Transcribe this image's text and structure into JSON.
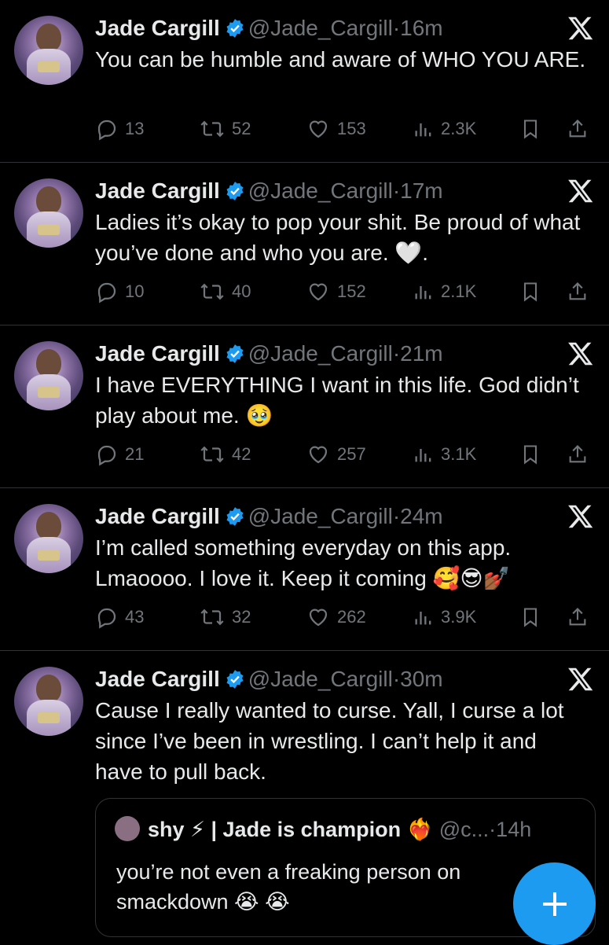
{
  "tweets": [
    {
      "name": "Jade Cargill",
      "handle": "@Jade_Cargill",
      "dot": "·",
      "time": "16m",
      "text": "You can be humble and aware of WHO YOU ARE.",
      "replies": "13",
      "reposts": "52",
      "likes": "153",
      "views": "2.3K"
    },
    {
      "name": "Jade Cargill",
      "handle": "@Jade_Cargill",
      "dot": "·",
      "time": "17m",
      "text": "Ladies it’s okay to pop your shit. Be proud of what you’ve done and who you are. 🤍.",
      "replies": "10",
      "reposts": "40",
      "likes": "152",
      "views": "2.1K"
    },
    {
      "name": "Jade Cargill",
      "handle": "@Jade_Cargill",
      "dot": "·",
      "time": "21m",
      "text": "I have EVERYTHING I want in this life. God didn’t play about me. 🥹",
      "replies": "21",
      "reposts": "42",
      "likes": "257",
      "views": "3.1K"
    },
    {
      "name": "Jade Cargill",
      "handle": "@Jade_Cargill",
      "dot": "·",
      "time": "24m",
      "text": "I’m called something everyday on this app. Lmaoooo. I love it. Keep it coming 🥰😎💅🏾",
      "replies": "43",
      "reposts": "32",
      "likes": "262",
      "views": "3.9K"
    },
    {
      "name": "Jade Cargill",
      "handle": "@Jade_Cargill",
      "dot": "·",
      "time": "30m",
      "text": "Cause I really wanted to curse. Yall, I curse a lot since I’ve been in wrestling. I can’t help it and have to pull back."
    }
  ],
  "quote": {
    "name": "shy ⚡ | Jade is champion ❤️‍🔥",
    "handle": "@c...",
    "dot": "·",
    "time": "14h",
    "text": "you’re not even a freaking person on smackdown 😭 😭"
  },
  "icons": {
    "reply": "reply-icon",
    "repost": "repost-icon",
    "like": "like-icon",
    "views": "views-icon",
    "bookmark": "bookmark-icon",
    "share": "share-icon",
    "x": "x-logo-icon",
    "compose": "compose-plus-icon",
    "verified": "verified-badge-icon"
  },
  "colors": {
    "background": "#000000",
    "text": "#e7e9ea",
    "muted": "#71767b",
    "accent": "#1d9bf0",
    "divider": "#2f3336"
  }
}
